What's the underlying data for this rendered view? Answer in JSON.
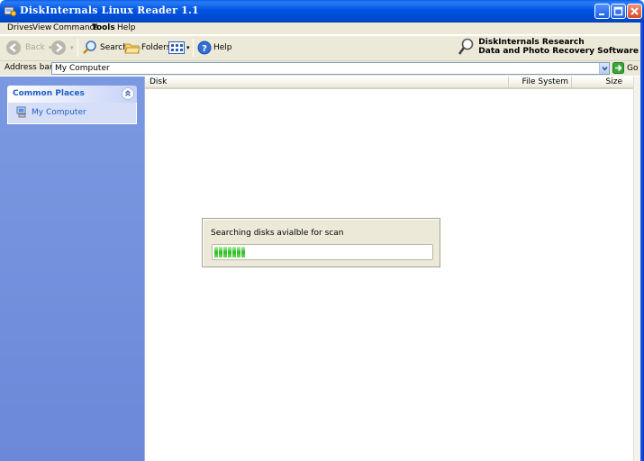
{
  "window": {
    "title": "DiskInternals Linux Reader 1.1"
  },
  "menu": [
    "Drives",
    "View",
    "Commands",
    "Tools",
    "Help"
  ],
  "toolbar": {
    "back": "Back",
    "search": "Search",
    "folders": "Folders",
    "help": "Help",
    "brand_line1": "DiskInternals Research",
    "brand_line2": "Data and Photo Recovery Software"
  },
  "address": {
    "label": "Address bar:",
    "value": "My Computer",
    "go": "Go"
  },
  "sidebar": {
    "panel_title": "Common Places",
    "items": [
      {
        "label": "My Computer"
      }
    ]
  },
  "file_list": {
    "columns": [
      "Disk",
      "File System",
      "Size"
    ],
    "rows": []
  },
  "progress_dialog": {
    "message": "Searching disks avialble for scan",
    "progress": 0.14
  },
  "colors": {
    "titlebar": "#0054e3",
    "sidebar": "#7b99e1",
    "link": "#215dc6",
    "progress": "#2dbb2d"
  }
}
